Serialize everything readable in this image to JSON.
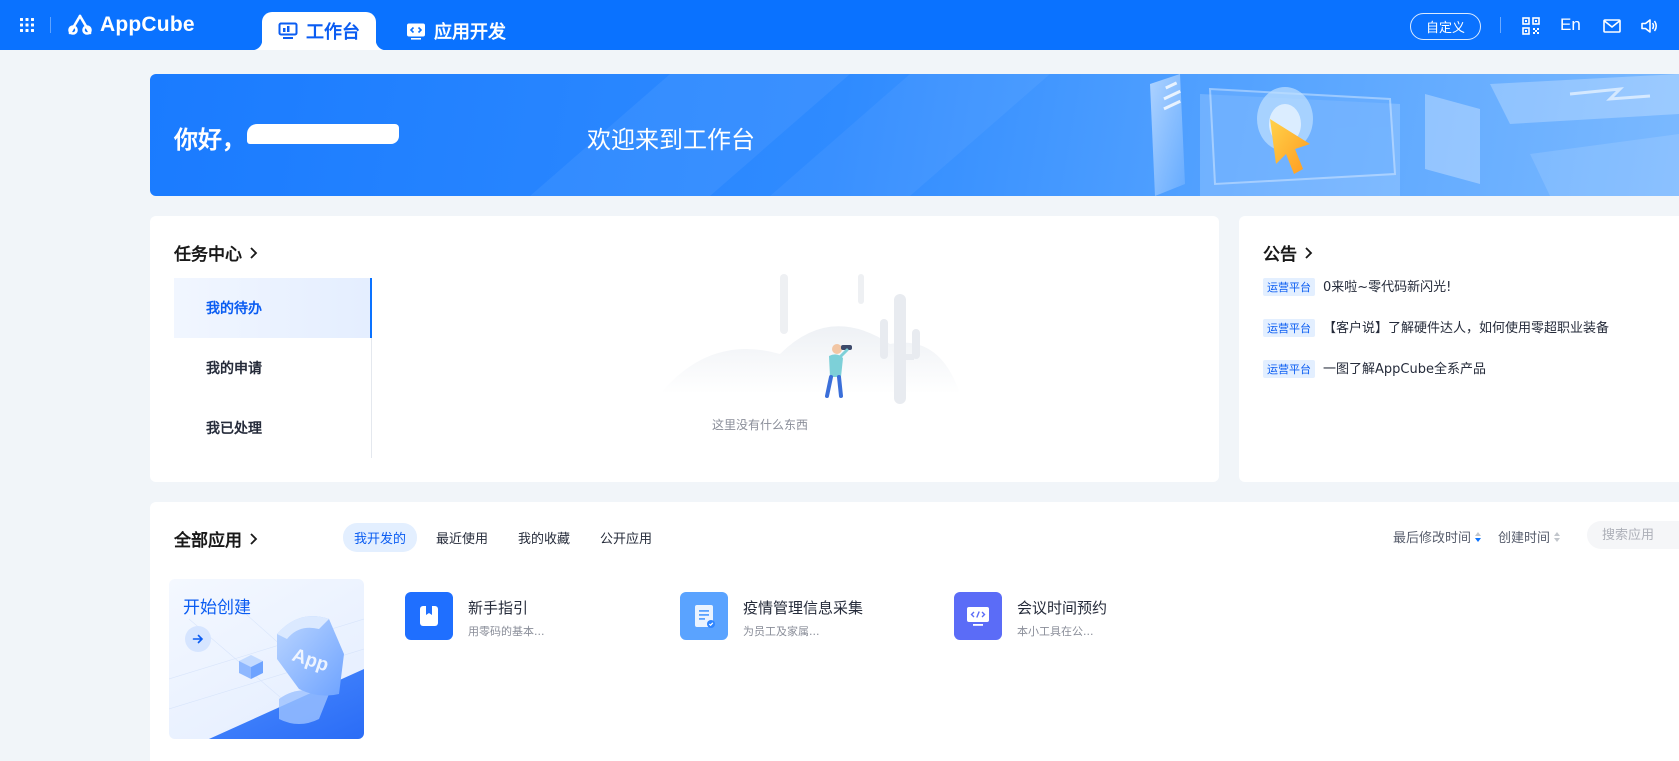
{
  "colors": {
    "brand": "#0a72ff",
    "accent_text": "#0a5cf2",
    "tag_bg": "#e3efff"
  },
  "topbar": {
    "logo_text": "AppCube",
    "tabs": [
      {
        "label": "工作台",
        "icon": "monitor-icon",
        "active": true
      },
      {
        "label": "应用开发",
        "icon": "code-window-icon",
        "active": false
      }
    ],
    "customize_label": "自定义",
    "lang_label": "En",
    "icons": [
      "apps-grid-icon",
      "qr-code-icon",
      "mail-icon",
      "speaker-icon"
    ]
  },
  "banner": {
    "greeting": "你好，",
    "welcome": "欢迎来到工作台"
  },
  "task_center": {
    "title": "任务中心",
    "menu": [
      {
        "label": "我的待办",
        "active": true
      },
      {
        "label": "我的申请",
        "active": false
      },
      {
        "label": "我已处理",
        "active": false
      }
    ],
    "empty_text": "这里没有什么东西"
  },
  "notices": {
    "title": "公告",
    "items": [
      {
        "tag": "运营平台",
        "text": "0来啦~零代码新闪光!"
      },
      {
        "tag": "运营平台",
        "text": "【客户说】了解硬件达人，如何使用零超职业装备"
      },
      {
        "tag": "运营平台",
        "text": "一图了解AppCube全系产品"
      }
    ]
  },
  "apps": {
    "title": "全部应用",
    "filters": [
      {
        "label": "我开发的",
        "active": true
      },
      {
        "label": "最近使用",
        "active": false
      },
      {
        "label": "我的收藏",
        "active": false
      },
      {
        "label": "公开应用",
        "active": false
      }
    ],
    "sort": [
      "最后修改时间",
      "创建时间"
    ],
    "search_placeholder": "搜索应用",
    "create_label": "开始创建",
    "create_badge": "App",
    "list": [
      {
        "name": "新手指引",
        "desc": "用零码的基本...",
        "icon": "bookmark-icon",
        "color": "#1f6fff"
      },
      {
        "name": "疫情管理信息采集",
        "desc": "为员工及家属...",
        "icon": "form-icon",
        "color": "#5aa3ff"
      },
      {
        "name": "会议时间预约",
        "desc": "本小工具在公...",
        "icon": "code-screen-icon",
        "color": "#5b6cf7"
      }
    ]
  }
}
